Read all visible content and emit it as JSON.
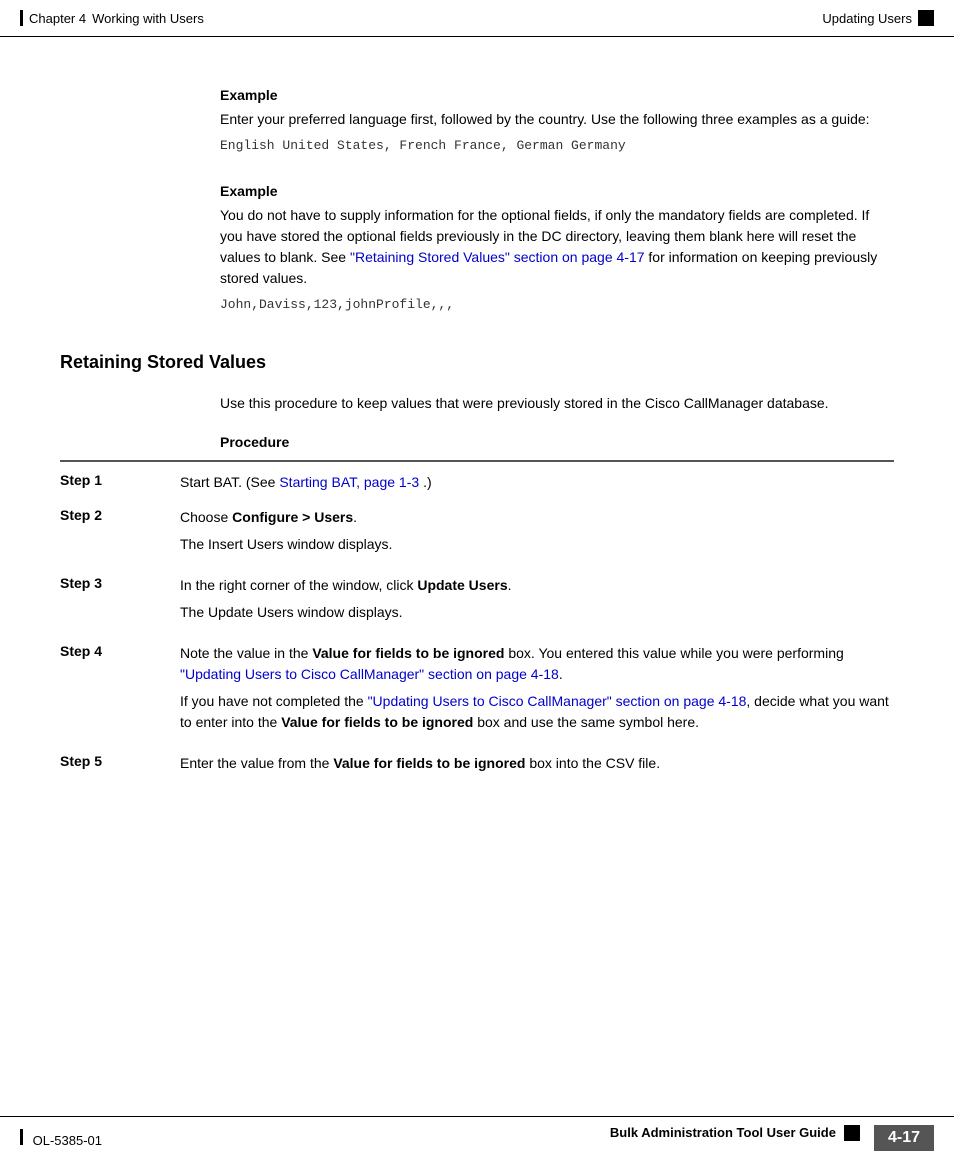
{
  "header": {
    "chapter": "Chapter 4",
    "chapter_title": "Working with Users",
    "section_title": "Updating Users"
  },
  "content": {
    "example1": {
      "heading": "Example",
      "body": "Enter your preferred language first, followed by the country. Use the following three examples as a guide:",
      "code": "English United States, French France, German Germany"
    },
    "example2": {
      "heading": "Example",
      "body1": "You do not have to supply information for the optional fields, if only the mandatory fields are completed. If you have stored the optional fields previously in the DC directory, leaving them blank here will reset the values to blank. See",
      "link1_text": "\"Retaining Stored Values\" section on page 4-17",
      "body1b": "for information on keeping previously stored values.",
      "code": "John,Daviss,123,johnProfile,,,"
    },
    "section": {
      "heading": "Retaining Stored Values",
      "intro": "Use this procedure to keep values that were previously stored in the Cisco CallManager database.",
      "procedure_heading": "Procedure",
      "steps": [
        {
          "label": "Step 1",
          "text": "Start BAT. (See ",
          "link_text": "Starting BAT, page 1-3",
          "text_after": ".)"
        },
        {
          "label": "Step 2",
          "text_before": "Choose ",
          "bold": "Configure > Users",
          "text_after": ".",
          "sub_text": "The Insert Users window displays."
        },
        {
          "label": "Step 3",
          "text_before": "In the right corner of the window, click ",
          "bold": "Update Users",
          "text_after": ".",
          "sub_text": "The Update Users window displays."
        },
        {
          "label": "Step 4",
          "text_before": "Note the value in the ",
          "bold1": "Value for fields to be ignored",
          "text_mid1": " box. You entered this value while you were performing ",
          "link1_text": "\"Updating Users to Cisco CallManager\" section on page 4-18",
          "text_end1": ".",
          "para2_before": "If you have not completed the ",
          "link2_text": "\"Updating Users to Cisco CallManager\" section on page 4-18",
          "para2_mid": ", decide what you want to enter into the ",
          "bold2": "Value for fields to be ignored",
          "para2_end": " box and use the same symbol here."
        },
        {
          "label": "Step 5",
          "text_before": "Enter the value from the ",
          "bold": "Value for fields to be ignored",
          "text_after": " box into the CSV file."
        }
      ]
    }
  },
  "footer": {
    "doc_number": "OL-5385-01",
    "guide_title": "Bulk Administration Tool User Guide",
    "page_number": "4-17"
  }
}
